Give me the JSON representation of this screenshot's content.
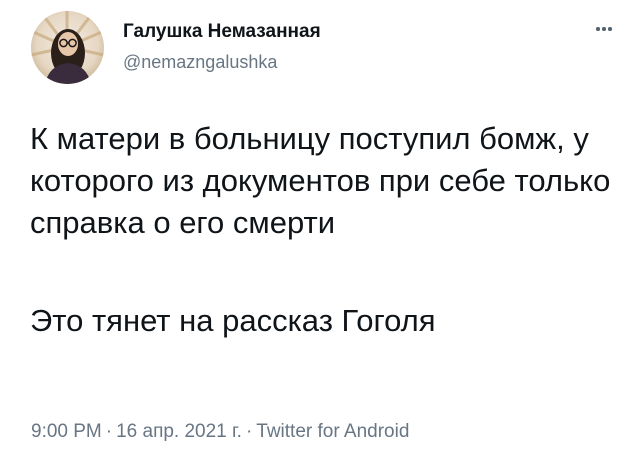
{
  "author": {
    "display_name": "Галушка Немазанная",
    "handle": "@nemazngalushka"
  },
  "icons": {
    "avatar": "user-avatar",
    "more": "more-horizontal-icon"
  },
  "tweet": {
    "paragraph_1": "К матери в больницу поступил бомж, у которого из документов при себе только справка о его смерти",
    "paragraph_2": "Это тянет на рассказ Гоголя"
  },
  "meta": {
    "time": "9:00 PM",
    "separator": "·",
    "date": "16 апр. 2021 г.",
    "source": "Twitter for Android"
  },
  "colors": {
    "text": "#0f1419",
    "secondary": "#687684",
    "background": "#ffffff"
  }
}
